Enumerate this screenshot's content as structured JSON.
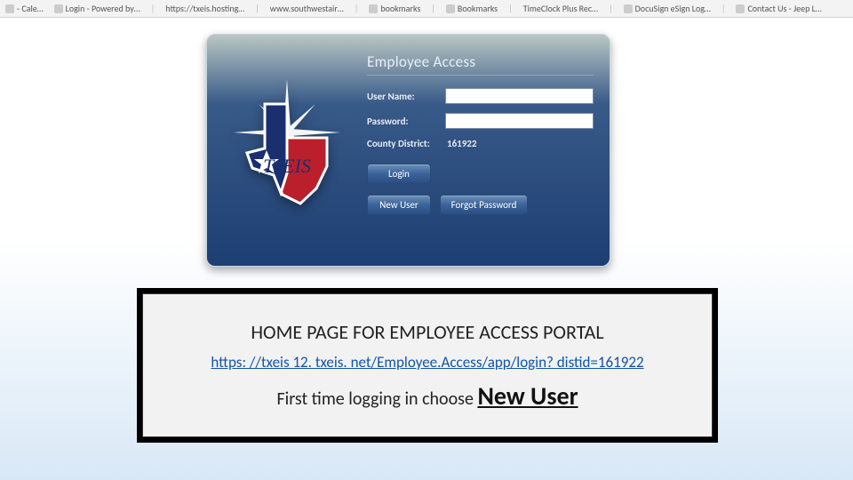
{
  "bookmarks": {
    "items": [
      "- Cale…",
      "Login - Powered by…",
      "https://txeis.hosting…",
      "www.southwestair…",
      "bookmarks",
      "Bookmarks",
      "TimeClock Plus Rec…",
      "DocuSign eSign Log…",
      "Contact Us - Jeep L…"
    ]
  },
  "login": {
    "title": "Employee Access",
    "username_label": "User Name:",
    "username_value": "",
    "password_label": "Password:",
    "password_value": "",
    "district_label": "County District:",
    "district_value": "161922",
    "login_btn": "Login",
    "newuser_btn": "New User",
    "forgot_btn": "Forgot Password"
  },
  "logo": {
    "brand": "TxEIS"
  },
  "caption": {
    "title": "HOME PAGE FOR EMPLOYEE ACCESS PORTAL",
    "link": "https: //txeis 12. txeis. net/Employee.Access/app/login? distid=161922",
    "note_prefix": "First time logging in choose ",
    "note_emph": "New User"
  }
}
